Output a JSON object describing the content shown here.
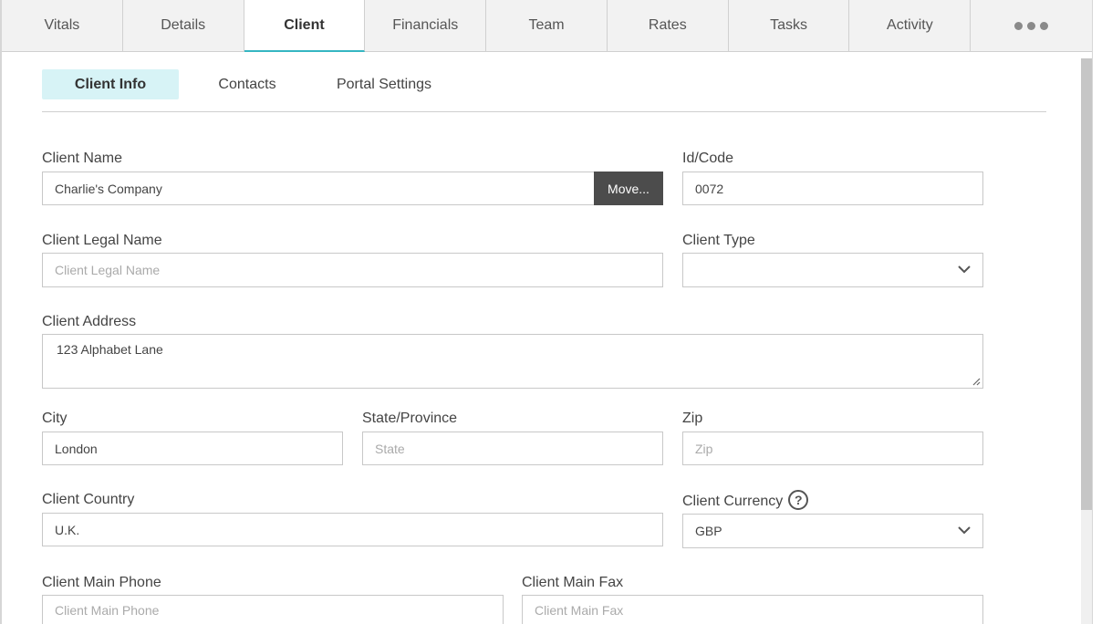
{
  "tabs": [
    {
      "label": "Vitals"
    },
    {
      "label": "Details"
    },
    {
      "label": "Client",
      "active": true
    },
    {
      "label": "Financials"
    },
    {
      "label": "Team"
    },
    {
      "label": "Rates"
    },
    {
      "label": "Tasks"
    },
    {
      "label": "Activity"
    }
  ],
  "more_icon": "more-dots-icon",
  "subtabs": [
    {
      "label": "Client Info",
      "active": true
    },
    {
      "label": "Contacts"
    },
    {
      "label": "Portal Settings"
    }
  ],
  "accent_color": "#35b6c2",
  "form": {
    "client_name": {
      "label": "Client Name",
      "value": "Charlie's Company",
      "move_label": "Move..."
    },
    "id_code": {
      "label": "Id/Code",
      "value": "0072"
    },
    "legal_name": {
      "label": "Client Legal Name",
      "placeholder": "Client Legal Name"
    },
    "client_type": {
      "label": "Client Type",
      "value": ""
    },
    "address": {
      "label": "Client Address",
      "value": "123 Alphabet Lane"
    },
    "city": {
      "label": "City",
      "value": "London"
    },
    "state": {
      "label": "State/Province",
      "placeholder": "State"
    },
    "zip": {
      "label": "Zip",
      "placeholder": "Zip"
    },
    "country": {
      "label": "Client Country",
      "value": "U.K."
    },
    "currency": {
      "label": "Client Currency",
      "value": "GBP",
      "help_icon": "?"
    },
    "main_phone": {
      "label": "Client Main Phone",
      "placeholder": "Client Main Phone"
    },
    "main_fax": {
      "label": "Client Main Fax",
      "placeholder": "Client Main Fax"
    }
  }
}
